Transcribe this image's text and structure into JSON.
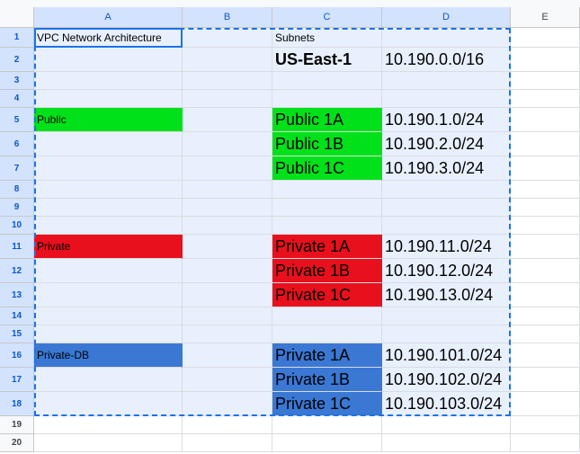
{
  "columns": [
    "A",
    "B",
    "C",
    "D",
    "E"
  ],
  "rows": [
    "1",
    "2",
    "3",
    "4",
    "5",
    "6",
    "7",
    "8",
    "9",
    "10",
    "11",
    "12",
    "13",
    "14",
    "15",
    "16",
    "17",
    "18",
    "19",
    "20"
  ],
  "colors": {
    "public_green": "#00e11a",
    "private_red": "#e8101c",
    "db_blue": "#3a78d4",
    "selection_tint": "#e8f0fe",
    "selection_border": "#1a73e8"
  },
  "cells": {
    "A1": "VPC Network Architecture",
    "C1": "Subnets",
    "C2": "US-East-1",
    "D2": "10.190.0.0/16",
    "A5": "Public",
    "C5": "Public 1A",
    "D5": "10.190.1.0/24",
    "C6": "Public 1B",
    "D6": "10.190.2.0/24",
    "C7": "Public 1C",
    "D7": "10.190.3.0/24",
    "A11": "Private",
    "C11": "Private 1A",
    "D11": "10.190.11.0/24",
    "C12": "Private 1B",
    "D12": "10.190.12.0/24",
    "C13": "Private 1C",
    "D13": "10.190.13.0/24",
    "A16": "Private-DB",
    "C16": "Private 1A",
    "D16": "10.190.101.0/24",
    "C17": "Private 1B",
    "D17": "10.190.102.0/24",
    "C18": "Private 1C",
    "D18": "10.190.103.0/24"
  },
  "fills": {
    "A5": "public_green",
    "C5": "public_green",
    "C6": "public_green",
    "C7": "public_green",
    "A11": "private_red",
    "C11": "private_red",
    "C12": "private_red",
    "C13": "private_red",
    "A16": "db_blue",
    "C16": "db_blue",
    "C17": "db_blue",
    "C18": "db_blue"
  },
  "large_text_cells": [
    "C2",
    "D2",
    "C5",
    "D5",
    "C6",
    "D6",
    "C7",
    "D7",
    "C11",
    "D11",
    "C12",
    "D12",
    "C13",
    "D13",
    "C16",
    "D16",
    "C17",
    "D17",
    "C18",
    "D18"
  ],
  "bold_cells": [
    "C2"
  ],
  "selection": {
    "range": "A1:D18",
    "active_cell": "A1"
  }
}
